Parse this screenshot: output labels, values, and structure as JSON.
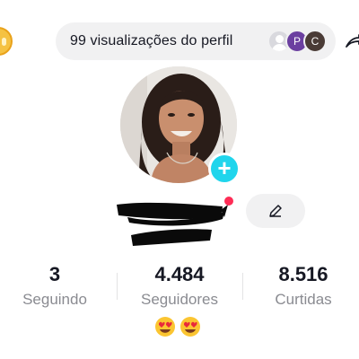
{
  "header": {
    "views_text": "99 visualizações do perfil",
    "viewer_avatars": [
      {
        "initial": ""
      },
      {
        "initial": "P",
        "color": "#6b3fa0"
      },
      {
        "initial": "C",
        "color": "#4a3b36"
      }
    ]
  },
  "profile": {
    "username_redacted": true,
    "has_unread_dot": true
  },
  "stats": {
    "following": {
      "value": "3",
      "label": "Seguindo"
    },
    "followers": {
      "value": "4.484",
      "label": "Seguidores"
    },
    "likes": {
      "value": "8.516",
      "label": "Curtidas"
    }
  },
  "bio": {
    "emojis": [
      "heart-eyes-emoji",
      "heart-eyes-emoji"
    ]
  },
  "colors": {
    "accent_add": "#20d5ec",
    "notification": "#fe2c55",
    "pill_bg": "#f1f1f2",
    "label_gray": "#8a8b91"
  },
  "icons": [
    "coin-icon",
    "default-user-icon",
    "share-arrow-icon",
    "plus-icon",
    "pencil-icon"
  ]
}
